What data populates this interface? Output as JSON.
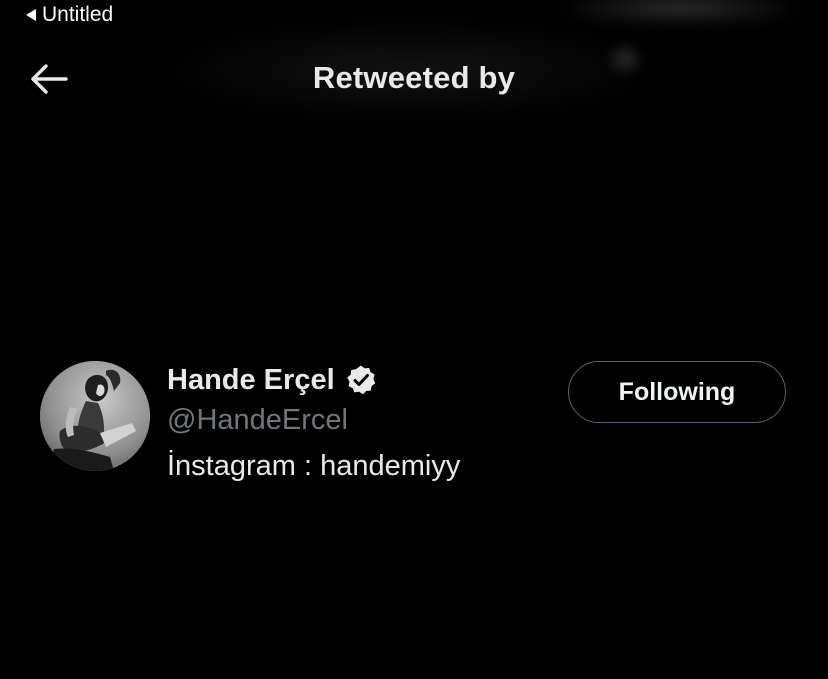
{
  "status_bar": {
    "back_label": "Untitled"
  },
  "header": {
    "title": "Retweeted by",
    "back_icon": "arrow-left-icon"
  },
  "users": [
    {
      "name": "Hande Erçel",
      "handle": "@HandeErcel",
      "bio": "İnstagram : handemiyy",
      "verified": true,
      "follow_label": "Following"
    }
  ],
  "colors": {
    "background": "#000000",
    "primary_text": "#e7e9ea",
    "secondary_text": "#71767b",
    "button_border": "#536471"
  }
}
